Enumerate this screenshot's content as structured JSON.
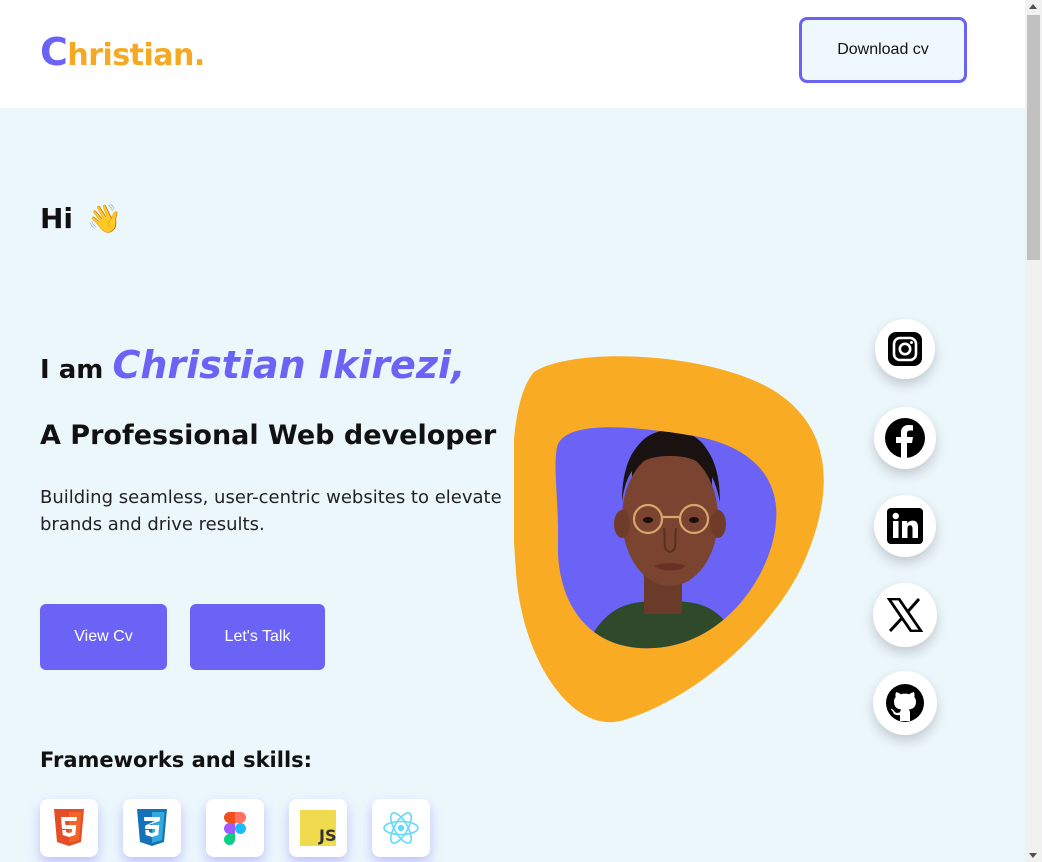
{
  "header": {
    "logo_initial": "C",
    "logo_rest": "hristian.",
    "download_label": "Download cv"
  },
  "hero": {
    "greeting": "Hi",
    "wave_emoji": "👋",
    "intro_prefix": "I am",
    "name": "Christian Ikirezi,",
    "role": "A Professional Web developer",
    "description": "Building seamless, user-centric websites to elevate brands and drive results.",
    "view_cv_label": "View Cv",
    "lets_talk_label": "Let's Talk"
  },
  "skills": {
    "title": "Frameworks and skills:",
    "items": [
      {
        "name": "html5-icon"
      },
      {
        "name": "css3-icon"
      },
      {
        "name": "figma-icon"
      },
      {
        "name": "javascript-icon",
        "text": "JS"
      },
      {
        "name": "react-icon"
      }
    ]
  },
  "socials": [
    "instagram-icon",
    "facebook-icon",
    "linkedin-icon",
    "x-icon",
    "github-icon"
  ],
  "colors": {
    "accent": "#6a63f6",
    "orange": "#f7a822",
    "hero_bg": "#ecf7fc",
    "button_bg": "#6a63f6"
  }
}
